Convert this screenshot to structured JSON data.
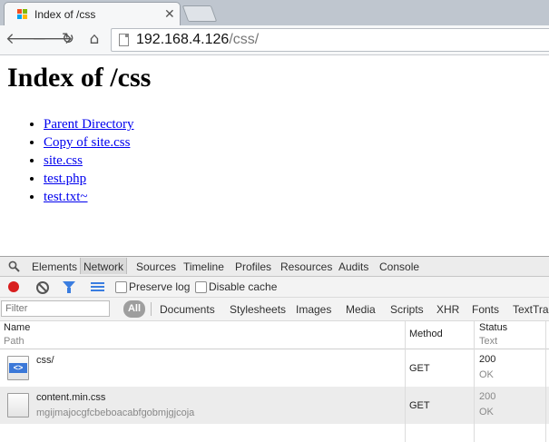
{
  "browser": {
    "tab_title": "Index of /css",
    "url_host": "192.168.4.126",
    "url_path": "/css/"
  },
  "page": {
    "heading": "Index of /css",
    "links": [
      "Parent Directory",
      "Copy of site.css",
      "site.css",
      "test.php",
      "test.txt~"
    ]
  },
  "devtools": {
    "tabs": [
      "Elements",
      "Network",
      "Sources",
      "Timeline",
      "Profiles",
      "Resources",
      "Audits",
      "Console"
    ],
    "selected_tab": "Network",
    "preserve_log_label": "Preserve log",
    "disable_cache_label": "Disable cache",
    "filter_placeholder": "Filter",
    "all_label": "All",
    "filter_types": [
      "Documents",
      "Stylesheets",
      "Images",
      "Media",
      "Scripts",
      "XHR",
      "Fonts",
      "TextTra"
    ],
    "columns": {
      "name": "Name",
      "path": "Path",
      "method": "Method",
      "status": "Status",
      "text": "Text"
    },
    "requests": [
      {
        "name": "css/",
        "path": "",
        "method": "GET",
        "status": "200",
        "status_text": "OK",
        "icon": "html-file-icon"
      },
      {
        "name": "content.min.css",
        "path": "mgijmajocgfcbeboacabfgobmjgjcoja",
        "method": "GET",
        "status": "200",
        "status_text": "OK",
        "icon": "css-file-icon"
      }
    ]
  },
  "colors": {
    "record_red": "#d81e1e",
    "accent_blue": "#3a7de0",
    "link_blue": "#0000ee"
  }
}
